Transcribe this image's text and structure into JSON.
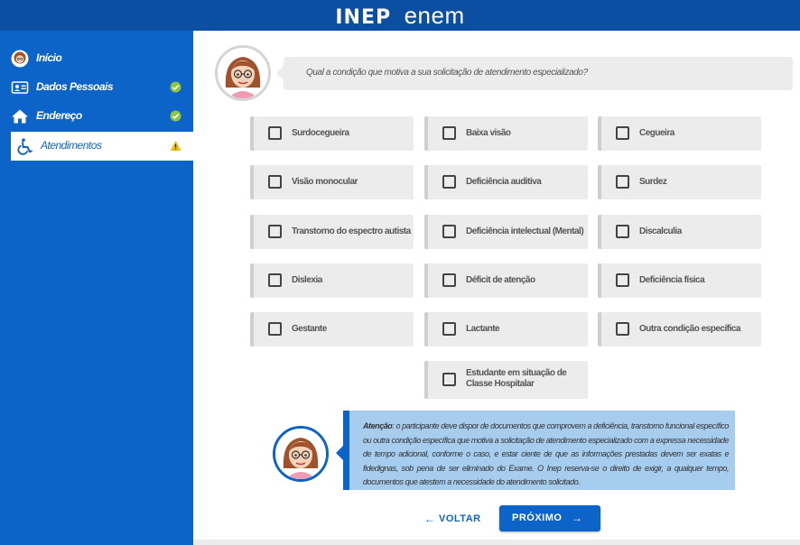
{
  "header": {
    "logo_inep": "INEP",
    "logo_enem": "enem",
    "background": "#0b4ea2"
  },
  "sidebar": {
    "background": "#0d64c8",
    "items": [
      {
        "label": "Início",
        "icon": "avatar-icon",
        "status": null,
        "active": false
      },
      {
        "label": "Dados Pessoais",
        "icon": "id-card-icon",
        "status": "complete",
        "active": false
      },
      {
        "label": "Endereço",
        "icon": "home-icon",
        "status": "complete",
        "active": false
      },
      {
        "label": "Atendimentos",
        "icon": "wheelchair-icon",
        "status": "warning",
        "active": true
      }
    ]
  },
  "question": {
    "text": "Qual a condição que motiva a sua solicitação de atendimento especializado?"
  },
  "options": [
    {
      "label": "Surdocegueira",
      "checked": false
    },
    {
      "label": "Baixa visão",
      "checked": false
    },
    {
      "label": "Cegueira",
      "checked": false
    },
    {
      "label": "Visão monocular",
      "checked": false
    },
    {
      "label": "Deficiência auditiva",
      "checked": false
    },
    {
      "label": "Surdez",
      "checked": false
    },
    {
      "label": "Transtorno do espectro autista",
      "checked": false
    },
    {
      "label": "Deficiência intelectual (Mental)",
      "checked": false
    },
    {
      "label": "Discalculia",
      "checked": false
    },
    {
      "label": "Dislexia",
      "checked": false
    },
    {
      "label": "Déficit de atenção",
      "checked": false
    },
    {
      "label": "Deficiência física",
      "checked": false
    },
    {
      "label": "Gestante",
      "checked": false
    },
    {
      "label": "Lactante",
      "checked": false
    },
    {
      "label": "Outra condição específica",
      "checked": false
    },
    {
      "label": "Estudante em situação de Classe Hospitalar",
      "checked": false
    }
  ],
  "notice": {
    "title": "Atenção",
    "body": ": o participante deve dispor de documentos que comprovem a deficiência, transtorno funcional específico ou outra condição específica que motiva a solicitação de atendimento especializado com a expressa necessidade de tempo adicional, conforme o caso, e estar ciente de que as informações prestadas devem ser exatas e fidedignas, sob pena de ser eliminado do Exame. O Inep reserva-se o direito de exigir, a qualquer tempo, documentos que atestem a necessidade do atendimento solicitado."
  },
  "buttons": {
    "back_label": "VOLTAR",
    "next_label": "PRÓXIMO"
  },
  "colors": {
    "primary": "#0d64c8",
    "success": "#8cc63f",
    "warning": "#f2c200",
    "option_bg": "#ececec",
    "notice_bg": "#a6ccee"
  }
}
